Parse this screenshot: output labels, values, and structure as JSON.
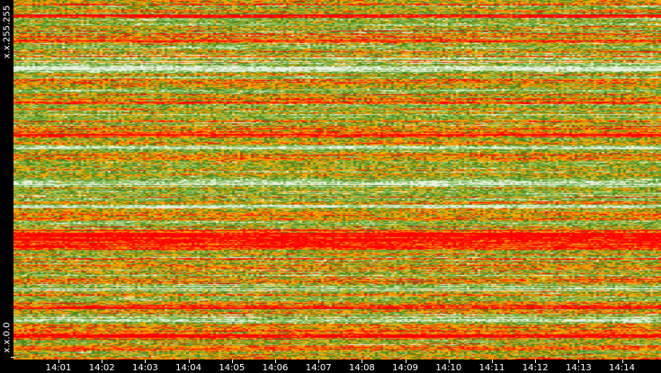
{
  "chart_data": {
    "type": "heatmap",
    "title": "",
    "xlabel": "",
    "ylabel": "",
    "x_ticks": [
      "14:01",
      "14:02",
      "14:03",
      "14:04",
      "14:05",
      "14:06",
      "14:07",
      "14:08",
      "14:09",
      "14:10",
      "14:11",
      "14:12",
      "14:13",
      "14:14"
    ],
    "y_labels": {
      "top": "x.x.255.255",
      "bottom": "x.x.0.0"
    },
    "color_scale": [
      "#e8f0e0",
      "#a8d080",
      "#7ab648",
      "#4e8a22",
      "#f0b000",
      "#f08000",
      "#ff2000",
      "#ff0000"
    ],
    "row_band_levels": [
      0.45,
      0.5,
      0.55,
      0.5,
      0.95,
      0.5,
      0.45,
      0.4,
      0.5,
      0.55,
      0.6,
      0.9,
      0.5,
      0.45,
      0.55,
      0.5,
      0.4,
      0.35,
      0.15,
      0.2,
      0.5,
      0.45,
      0.6,
      0.55,
      0.5,
      0.45,
      0.7,
      0.6,
      0.65,
      0.5,
      0.45,
      0.4,
      0.55,
      0.6,
      0.5,
      0.55,
      0.7,
      0.9,
      0.6,
      0.5,
      0.4,
      0.2,
      0.45,
      0.55,
      0.6,
      0.5,
      0.5,
      0.45,
      0.65,
      0.4,
      0.35,
      0.15,
      0.4,
      0.5,
      0.55,
      0.45,
      0.4,
      0.2,
      0.45,
      0.5,
      0.6,
      0.55,
      0.5,
      0.6,
      0.8,
      0.95,
      0.95,
      0.9,
      0.85,
      0.6,
      0.5,
      0.45,
      0.55,
      0.5,
      0.6,
      0.45,
      0.4,
      0.5,
      0.55,
      0.35,
      0.2,
      0.45,
      0.5,
      0.55,
      0.6,
      0.9,
      0.5,
      0.45,
      0.2,
      0.25,
      0.5,
      0.55,
      0.6,
      0.9,
      0.6,
      0.55,
      0.5,
      0.55,
      0.6,
      0.6
    ]
  }
}
